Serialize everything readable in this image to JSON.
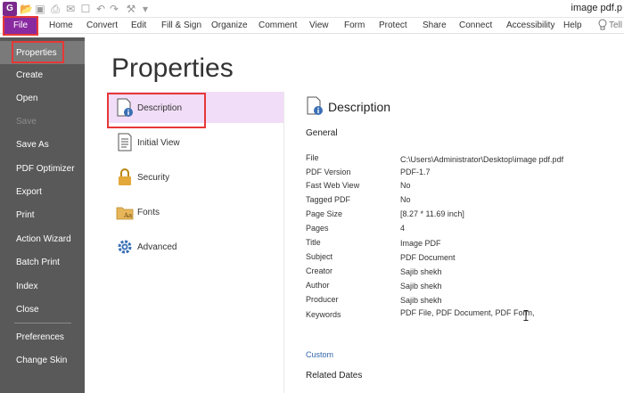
{
  "window": {
    "title": "image pdf.p"
  },
  "menu": {
    "file": "File",
    "items": [
      "Home",
      "Convert",
      "Edit",
      "Fill & Sign",
      "Organize",
      "Comment",
      "View",
      "Form",
      "Protect",
      "Share",
      "Connect",
      "Accessibility",
      "Help"
    ],
    "tell": "Tell"
  },
  "sidebar": {
    "items": [
      {
        "label": "Properties",
        "active": true,
        "disabled": false
      },
      {
        "label": "Create",
        "disabled": false
      },
      {
        "label": "Open",
        "disabled": false
      },
      {
        "label": "Save",
        "disabled": true
      },
      {
        "label": "Save As",
        "disabled": false
      },
      {
        "label": "PDF Optimizer",
        "disabled": false
      },
      {
        "label": "Export",
        "disabled": false
      },
      {
        "label": "Print",
        "disabled": false
      },
      {
        "label": "Action Wizard",
        "disabled": false
      },
      {
        "label": "Batch Print",
        "disabled": false
      },
      {
        "label": "Index",
        "disabled": false
      },
      {
        "label": "Close",
        "disabled": false
      },
      {
        "label": "Preferences",
        "disabled": false
      },
      {
        "label": "Change Skin",
        "disabled": false
      }
    ]
  },
  "page": {
    "title": "Properties"
  },
  "categories": [
    {
      "label": "Description",
      "icon": "document-info-icon",
      "active": true
    },
    {
      "label": "Initial View",
      "icon": "initial-view-icon"
    },
    {
      "label": "Security",
      "icon": "lock-icon"
    },
    {
      "label": "Fonts",
      "icon": "fonts-folder-icon"
    },
    {
      "label": "Advanced",
      "icon": "gear-icon"
    }
  ],
  "description": {
    "title": "Description",
    "general": "General",
    "properties": [
      {
        "label": "File",
        "value": "C:\\Users\\Administrator\\Desktop\\image pdf.pdf"
      },
      {
        "label": "PDF Version",
        "value": "PDF-1.7"
      },
      {
        "label": "Fast Web View",
        "value": "No"
      },
      {
        "label": "Tagged PDF",
        "value": "No"
      },
      {
        "label": "Page Size",
        "value": "[8.27 * 11.69 inch]"
      },
      {
        "label": "Pages",
        "value": "4"
      },
      {
        "label": "Title",
        "value": "Image PDF"
      },
      {
        "label": "Subject",
        "value": "PDF Document"
      },
      {
        "label": "Creator",
        "value": "Sajib shekh"
      },
      {
        "label": "Author",
        "value": "Sajib shekh"
      },
      {
        "label": "Producer",
        "value": "Sajib shekh"
      },
      {
        "label": "Keywords",
        "value": "PDF File, PDF Document, PDF Form,"
      }
    ],
    "custom": "Custom",
    "related_dates": "Related Dates"
  },
  "colors": {
    "accent": "#8a2aa0",
    "sidebar": "#595959",
    "highlight": "#e63838",
    "active_category": "#f1ddf7"
  }
}
